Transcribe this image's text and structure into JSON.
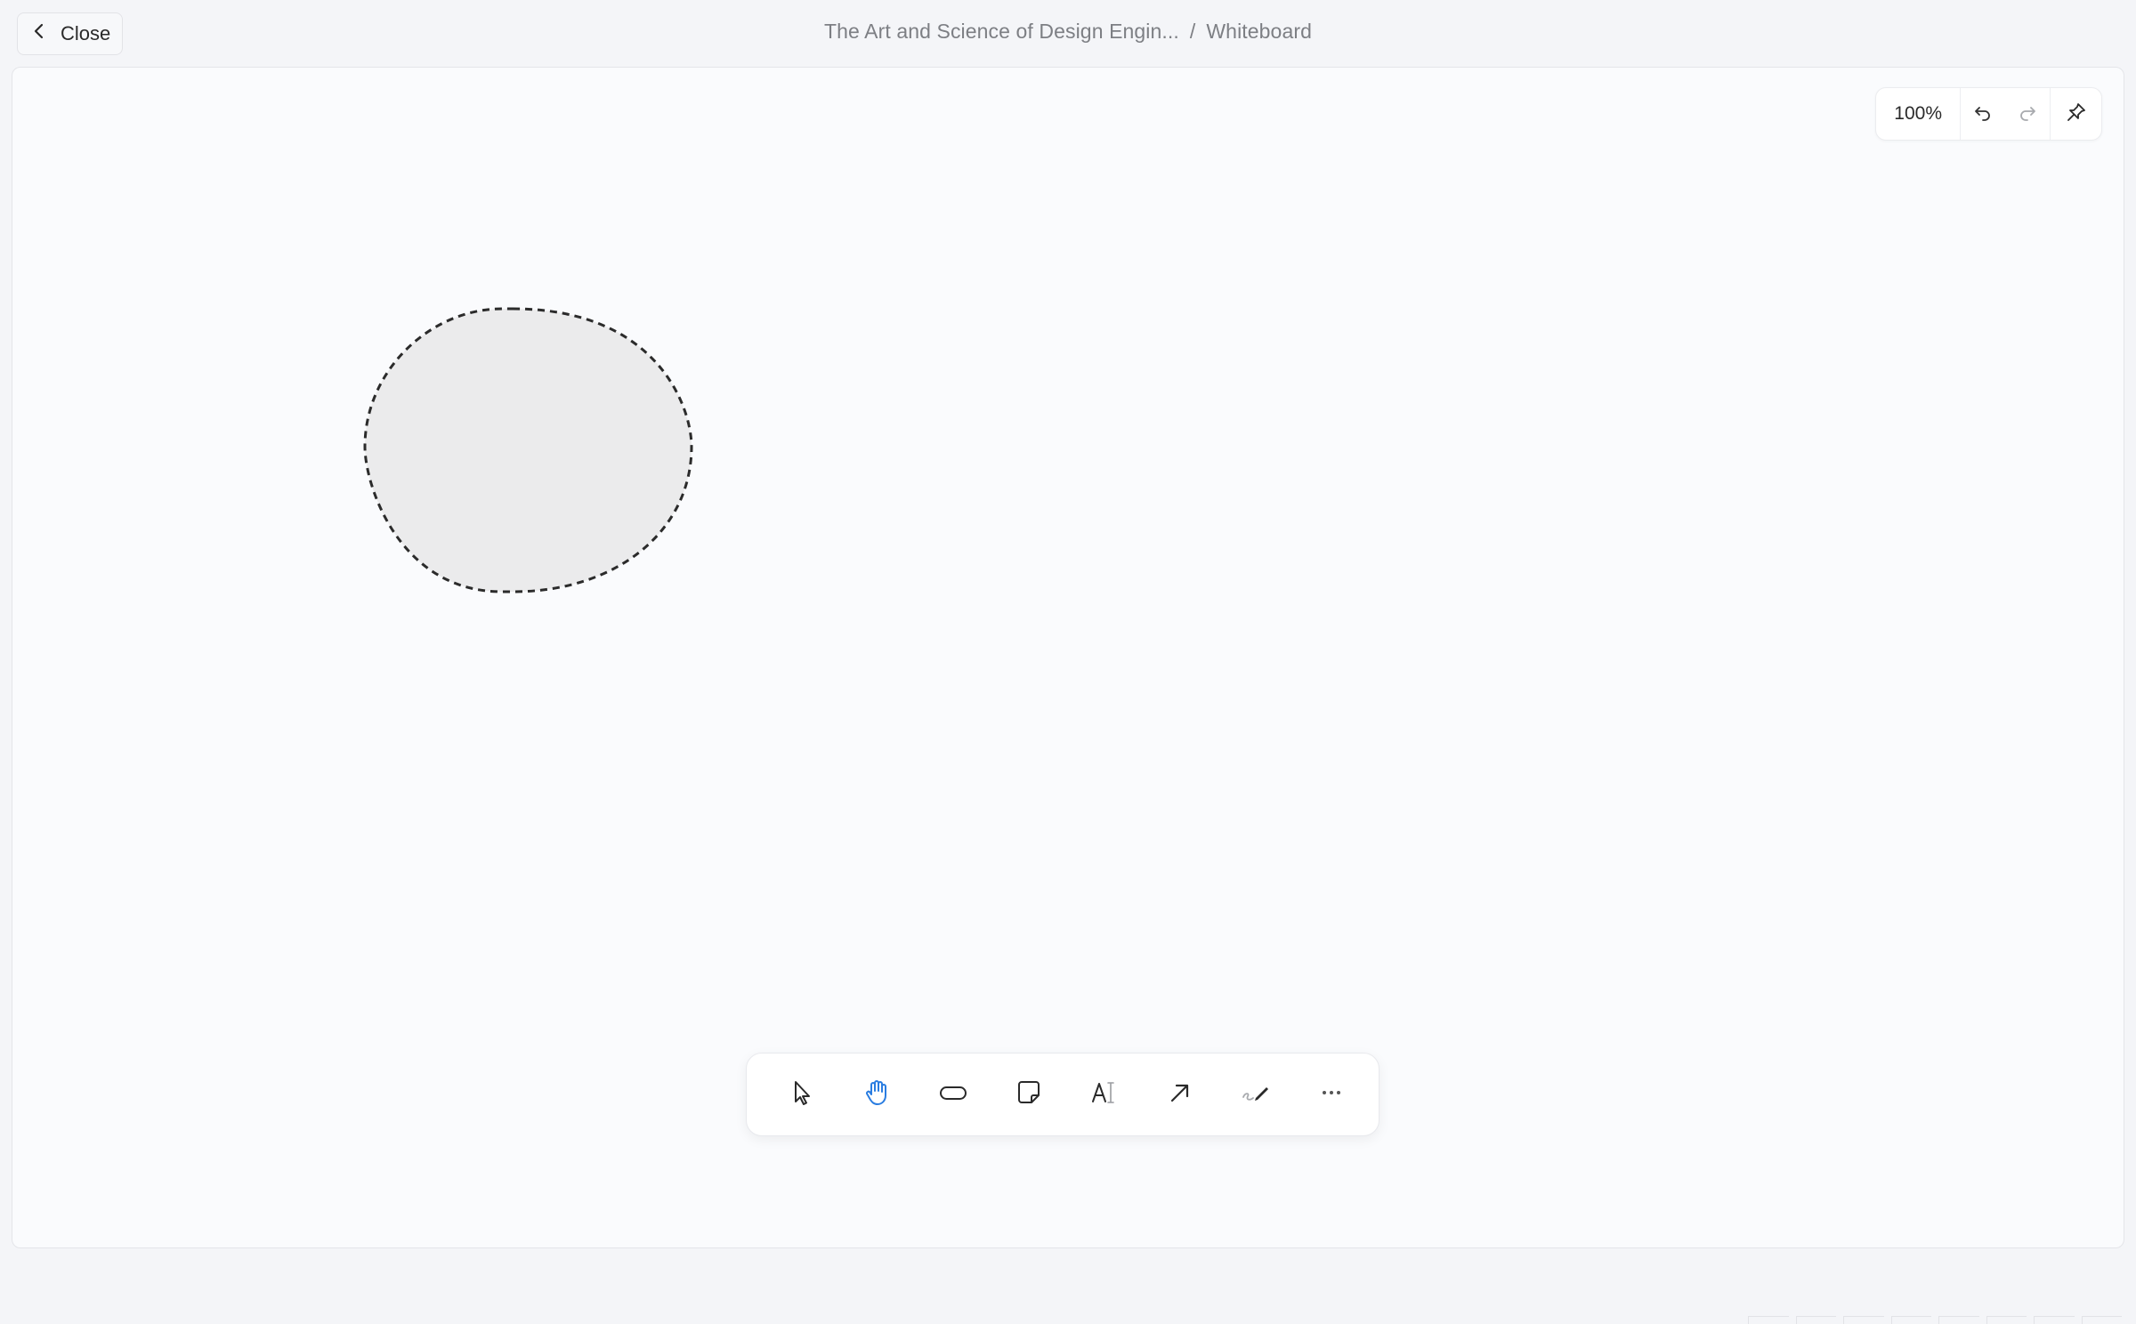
{
  "header": {
    "close_label": "Close",
    "breadcrumb_parent": "The Art and Science of Design Engin...",
    "breadcrumb_separator": "/",
    "breadcrumb_current": "Whiteboard"
  },
  "zoom_panel": {
    "zoom_level": "100%",
    "undo_icon": "undo-icon",
    "redo_icon": "redo-icon",
    "pin_icon": "pin-icon"
  },
  "canvas": {
    "shape": {
      "type": "rounded-ellipse",
      "fill": "#ebebec",
      "stroke": "#2b2b2b",
      "stroke_style": "dashed"
    }
  },
  "toolbar": {
    "active_tool": "hand",
    "active_color": "#2a7de1",
    "tools": [
      {
        "name": "select",
        "icon": "cursor-icon"
      },
      {
        "name": "hand",
        "icon": "hand-icon"
      },
      {
        "name": "shape",
        "icon": "rounded-rect-icon"
      },
      {
        "name": "sticky-note",
        "icon": "sticky-note-icon"
      },
      {
        "name": "text",
        "icon": "text-icon"
      },
      {
        "name": "arrow",
        "icon": "arrow-icon"
      },
      {
        "name": "pen",
        "icon": "pen-icon"
      },
      {
        "name": "more",
        "icon": "more-icon"
      }
    ]
  }
}
